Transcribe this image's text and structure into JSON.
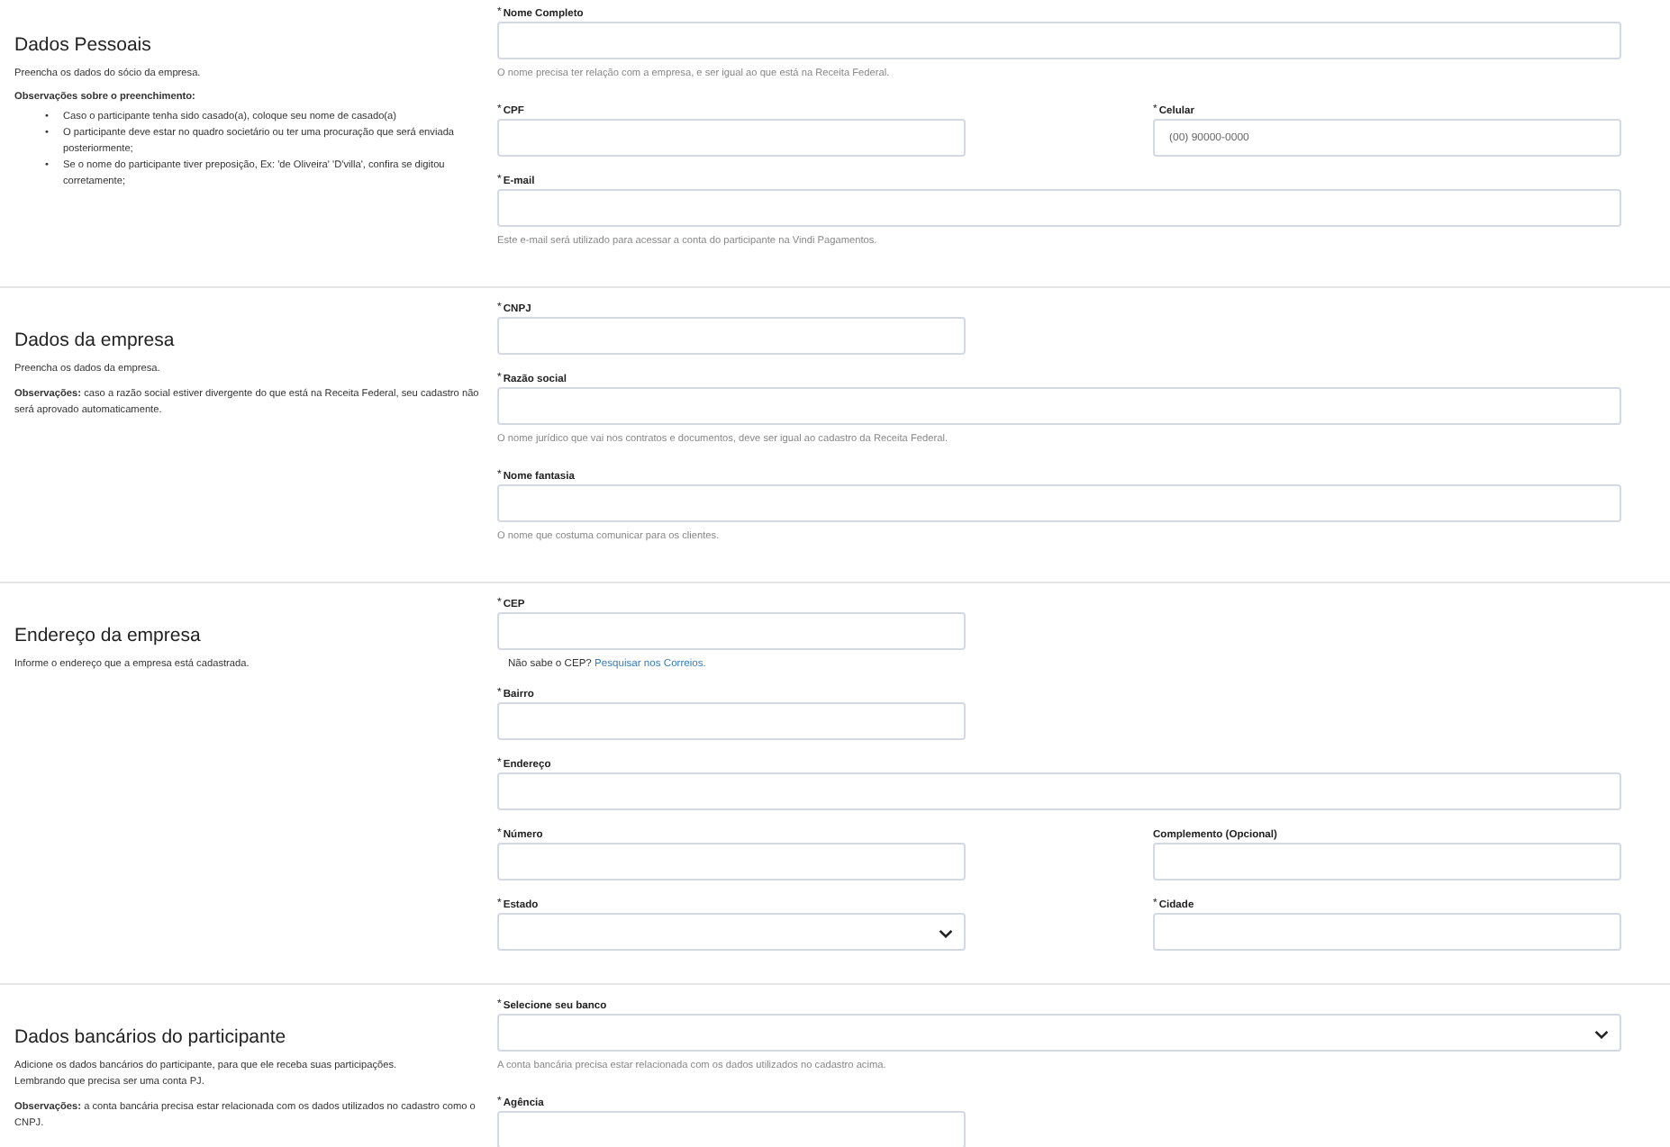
{
  "sections": [
    {
      "title": "Dados Pessoais",
      "description": "Preencha os dados do sócio da empresa.",
      "notes_title": "Observações sobre o preenchimento:",
      "bullets": [
        {
          "marker": "•",
          "text": "Caso o participante tenha sido casado(a), coloque seu nome de casado(a)"
        },
        {
          "marker": "•",
          "text": "O participante deve estar no quadro societário ou ter uma procuração que será enviada posteriormente;"
        },
        {
          "marker": "•",
          "text": "Se o nome do participante tiver preposição, Ex: 'de Oliveira' 'D'villa', confira se digitou corretamente;"
        }
      ],
      "rows": [
        [
          {
            "label": "Nome Completo",
            "mark": "*",
            "kind": "input",
            "full_width": true,
            "help": "O nome precisa ter relação com a empresa, e ser igual ao que está na Receita Federal."
          }
        ],
        [
          {
            "label": "CPF",
            "mark": "*",
            "kind": "input",
            "full_width": false
          },
          {
            "label": "Celular",
            "mark": "*",
            "kind": "input",
            "full_width": false,
            "placeholder": "(00) 90000-0000"
          }
        ],
        [
          {
            "label": "E-mail",
            "mark": "*",
            "kind": "input",
            "full_width": true,
            "help": "Este e-mail será utilizado para acessar a conta do participante na Vindi Pagamentos."
          }
        ]
      ]
    },
    {
      "title": "Dados da empresa",
      "description": "Preencha os dados da empresa.",
      "note": "**Observações:** caso a razão social estiver divergente do que está na Receita Federal, seu cadastro não será aprovado automaticamente.",
      "rows": [
        [
          {
            "label": "CNPJ",
            "mark": "*",
            "kind": "input",
            "full_width": false
          }
        ],
        [
          {
            "label": "Razão social",
            "mark": "*",
            "kind": "input",
            "full_width": true,
            "help": "O nome jurídico que vai nos contratos e documentos, deve ser igual ao cadastro da Receita Federal."
          }
        ],
        [
          {
            "label": "Nome fantasia",
            "mark": "*",
            "kind": "input",
            "full_width": true,
            "help": "O nome que costuma comunicar para os clientes."
          }
        ]
      ]
    },
    {
      "title": "Endereço da empresa",
      "description": "Informe o endereço que a empresa está cadastrada.",
      "rows": [
        [
          {
            "label": "CEP",
            "mark": "*",
            "kind": "input",
            "full_width": false,
            "hint": "Não sabe o CEP?",
            "link": "Pesquisar nos Correios."
          }
        ],
        [
          {
            "label": "Bairro",
            "mark": "*",
            "kind": "input",
            "full_width": false
          }
        ],
        [
          {
            "label": "Endereço",
            "mark": "*",
            "kind": "input",
            "full_width": true
          }
        ],
        [
          {
            "label": "Número",
            "mark": "*",
            "kind": "input",
            "full_width": false
          },
          {
            "label": "Complemento (Opcional)",
            "kind": "input",
            "full_width": false
          }
        ],
        [
          {
            "label": "Estado",
            "mark": "*",
            "kind": "select",
            "full_width": false
          },
          {
            "label": "Cidade",
            "mark": "*",
            "kind": "input",
            "full_width": false
          }
        ]
      ]
    },
    {
      "title": "Dados bancários do participante",
      "description": "Adicione os dados bancários do participante, para que ele receba suas participações.\nLembrando que precisa ser uma conta PJ.",
      "note": "**Observações:** a conta bancária precisa estar relacionada com os dados utilizados no cadastro como o CNPJ.",
      "rows": [
        [
          {
            "label": "Selecione seu banco",
            "mark": "*",
            "kind": "select",
            "full_width": true,
            "help": "A conta bancária precisa estar relacionada com os dados utilizados no cadastro acima."
          }
        ],
        [
          {
            "label": "Agência",
            "mark": "*",
            "kind": "input",
            "full_width": false
          }
        ]
      ]
    }
  ]
}
